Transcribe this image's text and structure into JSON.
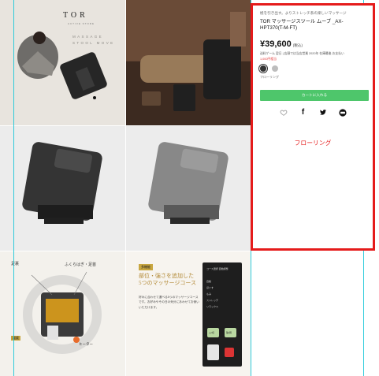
{
  "product": {
    "lead": "極を引き出す。よりストレッチ系の楽しいマッサージ",
    "name": "TOR マッサージスツール ムーブ _AX-HPT370(T-M-FT)",
    "price": "¥39,600",
    "tax_label": "(税込)",
    "note": "送料ゲーム 翌日 | 店頭では当店営業 2020年 在庫最後 お支払い",
    "stock": "1,000円相当",
    "selected_color": "フローリング",
    "color_label": "フローリング",
    "cart_label": "カートに入れる",
    "accent_color": "#e51b1b",
    "cart_color": "#4ec66b"
  },
  "share_icons": [
    "heart-icon",
    "facebook-icon",
    "twitter-icon",
    "line-icon"
  ],
  "images": {
    "logo": "TOR",
    "logo_sub": "ACTIVE STORE",
    "line1": "MASSAGE",
    "line2": "STOOL MOVE",
    "tile5_label1": "足裏",
    "tile5_label2": "ふくらはぎ・足首",
    "tile5_label3": "ヒーター",
    "tile5_badge": "温度",
    "tile6_badge": "多機能",
    "tile6_heading": "部位・強さを追加した\n5つのマッサージコース",
    "tile6_body": "好みに合わせて選べる5つのマッサージコースです。お好みやその日の気分にあわせてお使いいただけます。",
    "remote_title": "コース選択 自動調整",
    "remote_modes": [
      "自動",
      "ほぐす",
      "もみ",
      "ストレッチ",
      "リラックス"
    ],
    "remote_buttons": [
      "入/切",
      "強/弱"
    ]
  }
}
